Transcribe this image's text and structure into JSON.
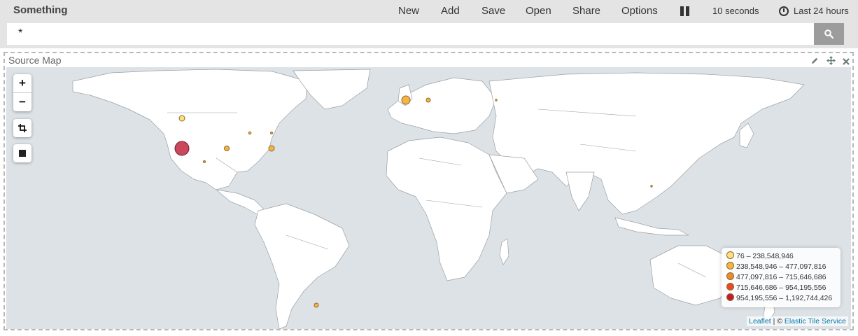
{
  "app": {
    "title": "Something"
  },
  "menu": {
    "new": "New",
    "add": "Add",
    "save": "Save",
    "open": "Open",
    "share": "Share",
    "options": "Options"
  },
  "refresh": {
    "interval": "10 seconds"
  },
  "timepicker": {
    "label": "Last 24 hours"
  },
  "query": {
    "value": "*"
  },
  "panel": {
    "title": "Source Map"
  },
  "map": {
    "controls": {
      "zoom_in": "+",
      "zoom_out": "−"
    },
    "legend": [
      {
        "label": "76 – 238,548,946",
        "color": "#ffe081"
      },
      {
        "label": "238,548,946 – 477,097,816",
        "color": "#f5b443"
      },
      {
        "label": "477,097,816 – 715,646,686",
        "color": "#f08a2c"
      },
      {
        "label": "715,646,686 – 954,195,556",
        "color": "#e84a25"
      },
      {
        "label": "954,195,556 – 1,192,744,426",
        "color": "#c41a2e"
      }
    ],
    "attribution": {
      "leaflet": "Leaflet",
      "separator": " | © ",
      "service": "Elastic Tile Service"
    }
  },
  "colors": {
    "land": "#ffffff",
    "water": "#dde2e6",
    "border": "#9aa0a4"
  },
  "icons": [
    "pause-icon",
    "clock-icon",
    "search-icon",
    "pencil-icon",
    "move-icon",
    "close-icon",
    "crop-icon",
    "square-icon"
  ]
}
